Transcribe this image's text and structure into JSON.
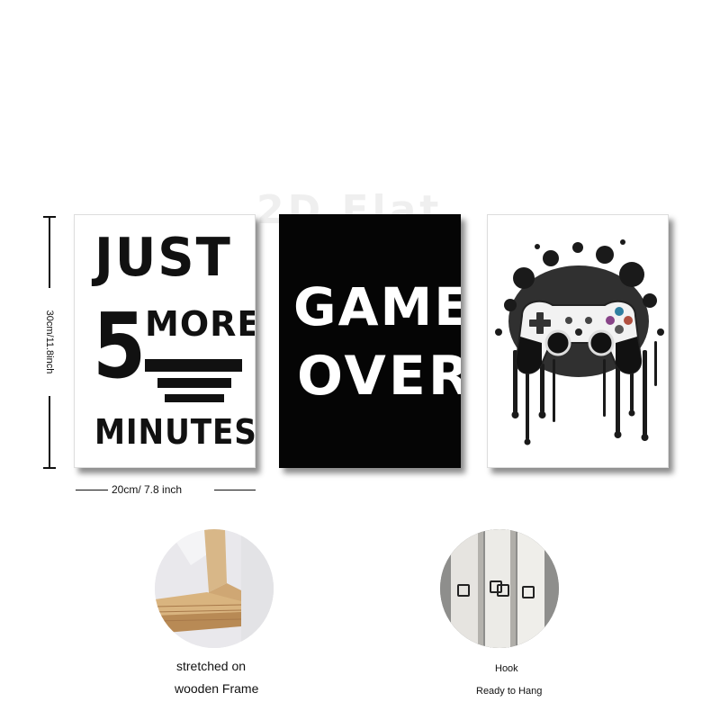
{
  "watermark": "2D Flat",
  "posters": [
    {
      "line1": "JUST",
      "number": "5",
      "word": "MORE",
      "line3": "MINUTES"
    },
    {
      "line1": "GAME",
      "line2": "OVER"
    },
    {
      "subject": "game-controller-splash-art"
    }
  ],
  "dimensions": {
    "height_label": "30cm/11.8inch",
    "width_label": "20cm/ 7.8 inch"
  },
  "features": [
    {
      "lines": [
        "stretched on",
        "wooden Frame"
      ],
      "icon": "wood-frame-photo"
    },
    {
      "lines": [
        "Hook",
        "Ready to Hang"
      ],
      "icon": "hook-photo"
    }
  ],
  "colors": {
    "black": "#050505",
    "white": "#ffffff"
  }
}
